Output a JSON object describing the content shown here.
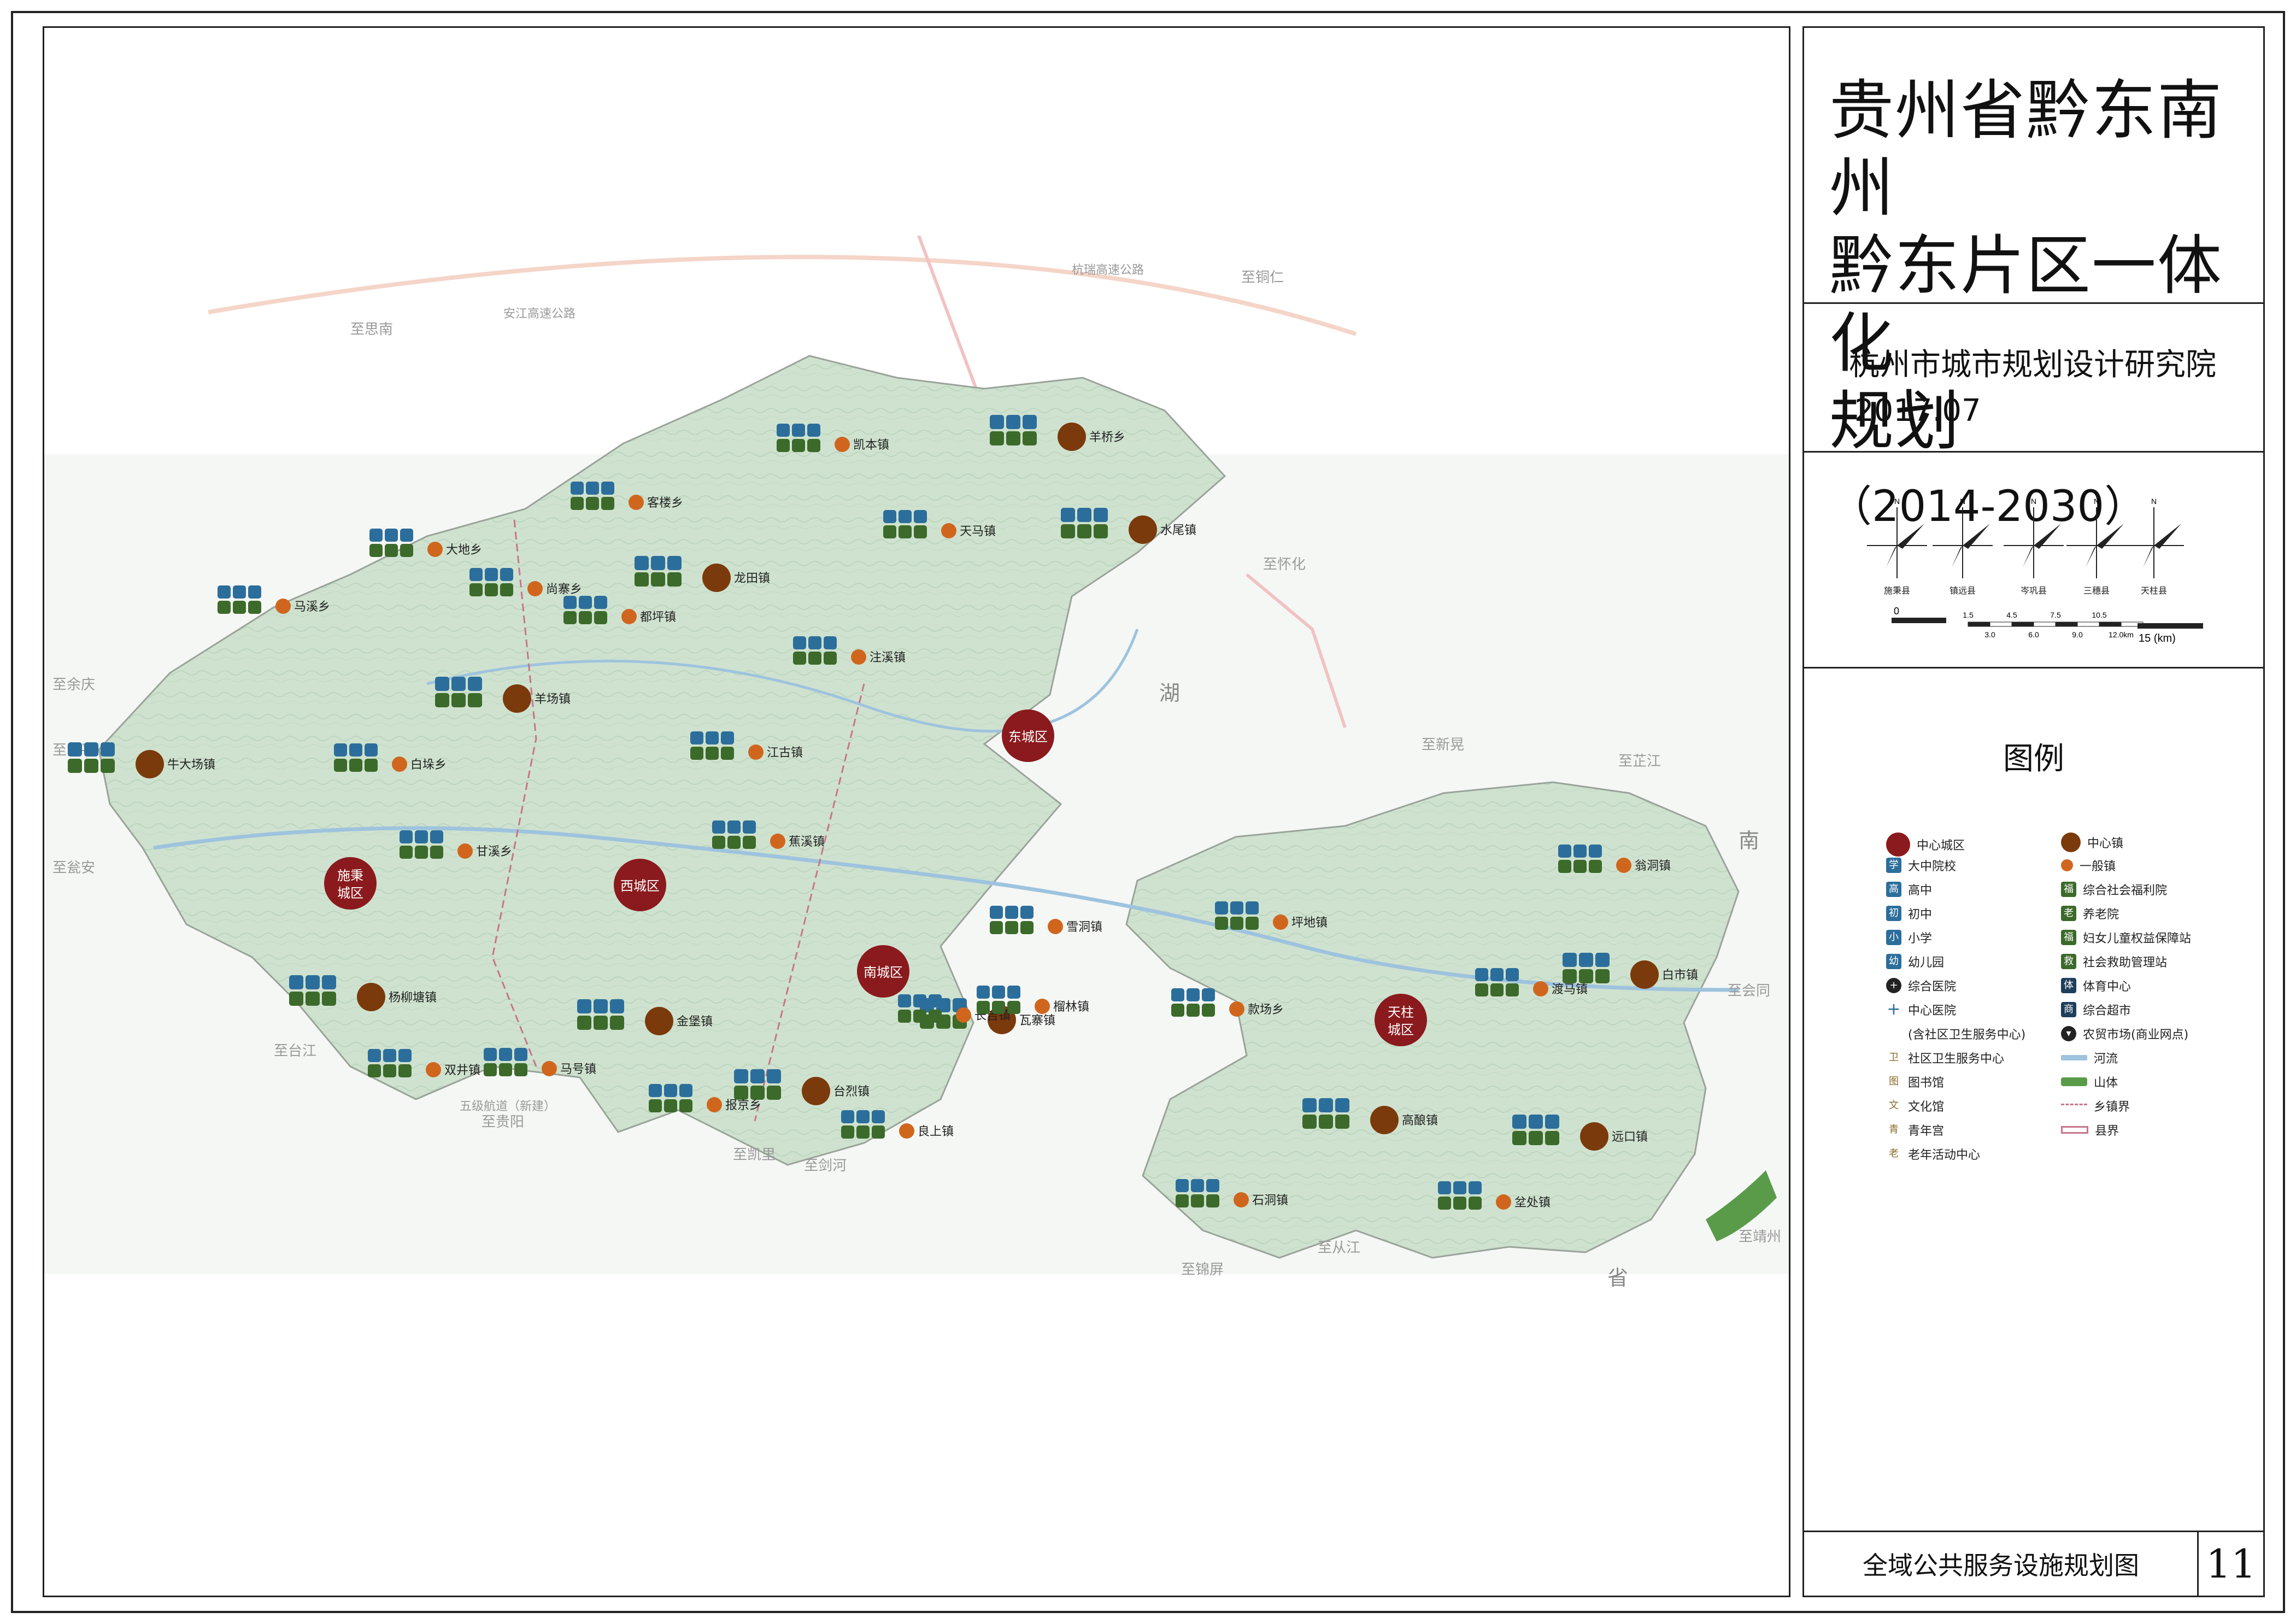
{
  "header": {
    "title_line1": "贵州省黔东南州",
    "title_line2": "黔东片区一体化",
    "title_line3": "规划",
    "title_years": "（2014-2030）"
  },
  "institute": {
    "name": "杭州市城市规划设计研究院",
    "date": "2017.07"
  },
  "scale": {
    "wind_roses": [
      "施秉县",
      "镇远县",
      "岑巩县",
      "三穗县",
      "天柱县"
    ],
    "bar1_ticks": [
      "0",
      "1.5",
      "3.0",
      "4.5",
      "6.0",
      "7.5",
      "9.0",
      "10.5",
      "12.0km"
    ],
    "bar2_label": "15 (km)",
    "bar2_zero": "0"
  },
  "legend": {
    "title": "图例",
    "colors": {
      "district": "#8a1a1d",
      "center_town": "#7b3a0c",
      "general_town": "#d0661e",
      "edu": "#2c6e9b",
      "welfare": "#3c6a2a",
      "river": "#9ec3de",
      "mountain": "#5a9b4a"
    },
    "left": [
      {
        "icon": "district-circle",
        "label": "中心城区"
      },
      {
        "icon": "学",
        "label": "大中院校"
      },
      {
        "icon": "高",
        "label": "高中"
      },
      {
        "icon": "初",
        "label": "初中"
      },
      {
        "icon": "小",
        "label": "小学"
      },
      {
        "icon": "幼",
        "label": "幼儿园"
      },
      {
        "icon": "hospital-icon",
        "label": "综合医院"
      },
      {
        "icon": "plus-icon",
        "label": "中心医院"
      },
      {
        "icon": "",
        "label": "(含社区卫生服务中心)"
      },
      {
        "icon": "卫",
        "label": "社区卫生服务中心"
      },
      {
        "icon": "图",
        "label": "图书馆"
      },
      {
        "icon": "文",
        "label": "文化馆"
      },
      {
        "icon": "青",
        "label": "青年宫"
      },
      {
        "icon": "老",
        "label": "老年活动中心"
      }
    ],
    "right": [
      {
        "icon": "center-town-circle",
        "label": "中心镇"
      },
      {
        "icon": "general-town-circle",
        "label": "一般镇"
      },
      {
        "icon": "福",
        "label": "综合社会福利院"
      },
      {
        "icon": "老",
        "label": "养老院"
      },
      {
        "icon": "福",
        "label": "妇女儿童权益保障站"
      },
      {
        "icon": "救",
        "label": "社会救助管理站"
      },
      {
        "icon": "体",
        "label": "体育中心"
      },
      {
        "icon": "商",
        "label": "综合超市"
      },
      {
        "icon": "basket-icon",
        "label": "农贸市场(商业网点)"
      },
      {
        "icon": "river-line",
        "label": "河流"
      },
      {
        "icon": "mountain-mark",
        "label": "山体"
      },
      {
        "icon": "town-boundary",
        "label": "乡镇界"
      },
      {
        "icon": "county-boundary",
        "label": "县界"
      }
    ]
  },
  "footer": {
    "map_title": "全域公共服务设施规划图",
    "page_number": "11"
  },
  "map": {
    "districts": [
      {
        "name": "东城区",
        "lines": [
          "东城区"
        ]
      },
      {
        "name": "西城区",
        "lines": [
          "西城区"
        ]
      },
      {
        "name": "南城区",
        "lines": [
          "南城区"
        ]
      },
      {
        "name": "施秉城区",
        "lines": [
          "施秉",
          "城区"
        ]
      },
      {
        "name": "天柱城区",
        "lines": [
          "天柱",
          "城区"
        ]
      }
    ],
    "center_towns": [
      "羊桥乡",
      "水尾镇",
      "龙田镇",
      "羊场镇",
      "牛大场镇",
      "杨柳塘镇",
      "金堡镇",
      "台烈镇",
      "瓦寨镇",
      "高酿镇",
      "远口镇",
      "白市镇"
    ],
    "general_towns": [
      "凯本镇",
      "客楼乡",
      "大地乡",
      "尚寨乡",
      "马溪乡",
      "都坪镇",
      "天马镇",
      "注溪镇",
      "江古镇",
      "白垛乡",
      "甘溪乡",
      "蕉溪镇",
      "雪洞镇",
      "坪地镇",
      "翁洞镇",
      "渡马镇",
      "款场乡",
      "长吉镇",
      "榴林镇",
      "良上镇",
      "报京乡",
      "马号镇",
      "双井镇",
      "石洞镇",
      "坌处镇"
    ],
    "place_labels": [
      "至思南",
      "至铜仁",
      "至怀化",
      "至新晃",
      "至芷江",
      "至会同",
      "至靖州",
      "至锦屏",
      "至从江",
      "至剑河",
      "至凯里",
      "至台江",
      "至贵阳",
      "至黄平",
      "至瓮安",
      "至余庆",
      "杭瑞高速公路",
      "安江高速公路",
      "湖",
      "南",
      "省",
      "五级航道（新建）"
    ]
  }
}
